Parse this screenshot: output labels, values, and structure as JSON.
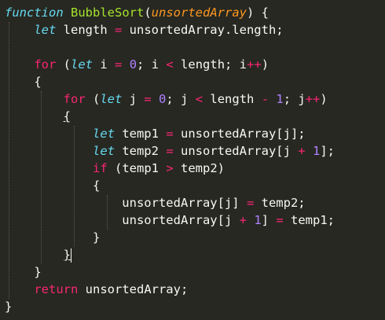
{
  "editor": {
    "theme_colors": {
      "background": "#272822",
      "keyword": "#66d9ef",
      "control": "#f92672",
      "function": "#a6e22e",
      "parameter": "#fd971f",
      "number": "#ae81ff",
      "text": "#f8f8f2"
    },
    "lines": [
      [
        [
          "kw",
          "function"
        ],
        [
          "txt",
          " "
        ],
        [
          "fn",
          "BubbleSort"
        ],
        [
          "txt",
          "("
        ],
        [
          "param",
          "unsortedArray"
        ],
        [
          "txt",
          ") {"
        ]
      ],
      [
        [
          "txt",
          "    "
        ],
        [
          "kw",
          "let"
        ],
        [
          "txt",
          " length "
        ],
        [
          "op",
          "="
        ],
        [
          "txt",
          " unsortedArray.length;"
        ]
      ],
      [],
      [
        [
          "txt",
          "    "
        ],
        [
          "kw2",
          "for"
        ],
        [
          "txt",
          " ("
        ],
        [
          "kw",
          "let"
        ],
        [
          "txt",
          " i "
        ],
        [
          "op",
          "="
        ],
        [
          "txt",
          " "
        ],
        [
          "num",
          "0"
        ],
        [
          "txt",
          "; i "
        ],
        [
          "op",
          "<"
        ],
        [
          "txt",
          " length; i"
        ],
        [
          "op",
          "++"
        ],
        [
          "txt",
          ")"
        ]
      ],
      [
        [
          "txt",
          "    {"
        ]
      ],
      [
        [
          "txt",
          "        "
        ],
        [
          "kw2",
          "for"
        ],
        [
          "txt",
          " ("
        ],
        [
          "kw",
          "let"
        ],
        [
          "txt",
          " j "
        ],
        [
          "op",
          "="
        ],
        [
          "txt",
          " "
        ],
        [
          "num",
          "0"
        ],
        [
          "txt",
          "; j "
        ],
        [
          "op",
          "<"
        ],
        [
          "txt",
          " length "
        ],
        [
          "op",
          "-"
        ],
        [
          "txt",
          " "
        ],
        [
          "num",
          "1"
        ],
        [
          "txt",
          "; j"
        ],
        [
          "op",
          "++"
        ],
        [
          "txt",
          ")"
        ]
      ],
      [
        [
          "txt",
          "        "
        ],
        [
          "hl",
          "{"
        ]
      ],
      [
        [
          "txt",
          "            "
        ],
        [
          "kw",
          "let"
        ],
        [
          "txt",
          " temp1 "
        ],
        [
          "op",
          "="
        ],
        [
          "txt",
          " unsortedArray[j];"
        ]
      ],
      [
        [
          "txt",
          "            "
        ],
        [
          "kw",
          "let"
        ],
        [
          "txt",
          " temp2 "
        ],
        [
          "op",
          "="
        ],
        [
          "txt",
          " unsortedArray[j "
        ],
        [
          "op",
          "+"
        ],
        [
          "txt",
          " "
        ],
        [
          "num",
          "1"
        ],
        [
          "txt",
          "];"
        ]
      ],
      [
        [
          "txt",
          "            "
        ],
        [
          "kw2",
          "if"
        ],
        [
          "txt",
          " (temp1 "
        ],
        [
          "op",
          ">"
        ],
        [
          "txt",
          " temp2)"
        ]
      ],
      [
        [
          "txt",
          "            {"
        ]
      ],
      [
        [
          "txt",
          "                unsortedArray[j] "
        ],
        [
          "op",
          "="
        ],
        [
          "txt",
          " temp2;"
        ]
      ],
      [
        [
          "txt",
          "                unsortedArray[j "
        ],
        [
          "op",
          "+"
        ],
        [
          "txt",
          " "
        ],
        [
          "num",
          "1"
        ],
        [
          "txt",
          "] "
        ],
        [
          "op",
          "="
        ],
        [
          "txt",
          " temp1;"
        ]
      ],
      [
        [
          "txt",
          "            }"
        ]
      ],
      [
        [
          "txt",
          "        "
        ],
        [
          "hl",
          "}"
        ],
        [
          "cursor",
          ""
        ]
      ],
      [
        [
          "txt",
          "    }"
        ]
      ],
      [
        [
          "txt",
          "    "
        ],
        [
          "kw2",
          "return"
        ],
        [
          "txt",
          " unsortedArray;"
        ]
      ],
      [
        [
          "txt",
          "}"
        ]
      ]
    ]
  }
}
